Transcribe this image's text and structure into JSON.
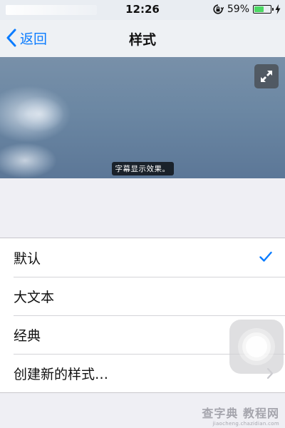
{
  "status_bar": {
    "time": "12:26",
    "battery_percent": "59%",
    "battery_level": 0.59,
    "battery_color": "#4cd964",
    "icons": [
      "orientation-lock-icon",
      "battery-icon",
      "charging-icon"
    ]
  },
  "nav": {
    "back_label": "返回",
    "title": "样式",
    "accent_color": "#0a7cff"
  },
  "preview": {
    "caption": "字幕显示效果。",
    "expand_icon": "expand-icon"
  },
  "style_options": {
    "selected": "默认",
    "items": [
      {
        "label": "默认",
        "checked": true
      },
      {
        "label": "大文本"
      },
      {
        "label": "经典"
      },
      {
        "label": "创建新的样式…",
        "disclosure": true
      }
    ]
  },
  "overlay": {
    "assistive_touch_icon": "assistive-touch-icon"
  },
  "watermark": {
    "text": "查字典 教程网",
    "url": "jiaocheng.chazidian.com"
  }
}
